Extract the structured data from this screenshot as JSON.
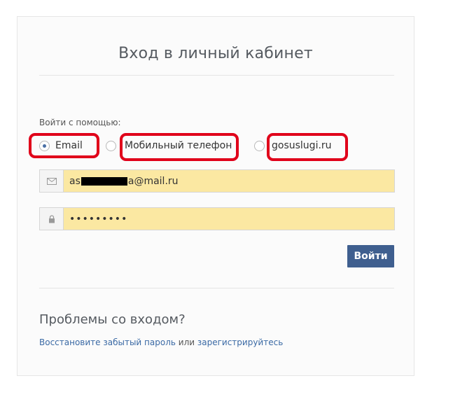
{
  "form": {
    "title": "Вход в личный кабинет",
    "login_with_label": "Войти с помощью:",
    "methods": [
      {
        "label": "Email",
        "selected": true
      },
      {
        "label": "Мобильный телефон",
        "selected": false
      },
      {
        "label": "gosuslugi.ru",
        "selected": false
      }
    ],
    "email": {
      "value_prefix": "as",
      "value_suffix": "a@mail.ru",
      "icon": "envelope-icon"
    },
    "password": {
      "value": "•••••••••",
      "icon": "lock-icon"
    },
    "submit_label": "Войти"
  },
  "help": {
    "title": "Проблемы со входом?",
    "recover_link": "Восстановите забытый пароль",
    "or_text": " или ",
    "register_link": "зарегистрируйтесь"
  },
  "colors": {
    "accent": "#3f5f8f",
    "autofill": "#fbe8a2",
    "highlight": "#e0001a",
    "link": "#3b6aa5"
  }
}
